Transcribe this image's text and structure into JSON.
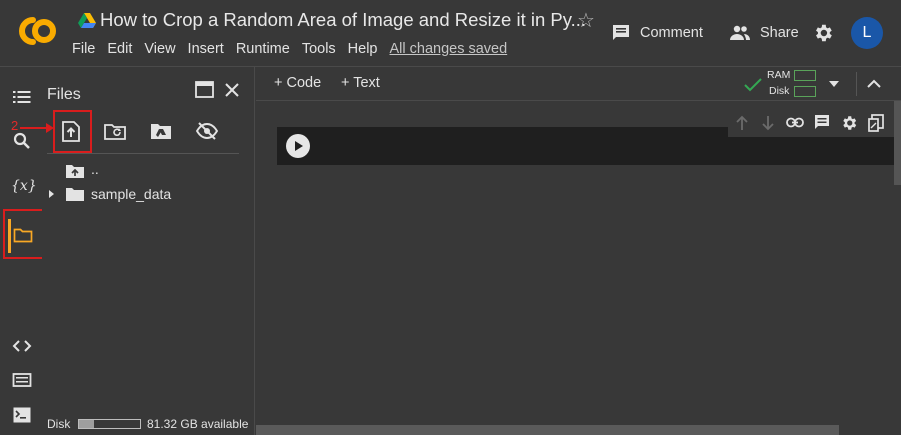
{
  "app": {
    "document_title": "How to Crop a Random Area of Image and Resize it in Py...",
    "menu": [
      "File",
      "Edit",
      "View",
      "Insert",
      "Runtime",
      "Tools",
      "Help"
    ],
    "save_status": "All changes saved",
    "comment_label": "Comment",
    "share_label": "Share",
    "avatar_initial": "L"
  },
  "files_panel": {
    "title": "Files",
    "parent_dir_label": "..",
    "folder_label": "sample_data",
    "disk_label": "Disk",
    "disk_available": "81.32 GB available",
    "disk_used_fraction": 0.24
  },
  "notebook": {
    "add_code_label": "+ Code",
    "add_text_label": "+ Text",
    "ram_label": "RAM",
    "disk_label": "Disk"
  },
  "annotations": {
    "step1": "1",
    "step2": "2"
  },
  "colors": {
    "background": "#383838",
    "cell": "#1f1f1f",
    "folder_active": "#f9a825",
    "annotation": "#d91d1d",
    "avatar": "#1a57a8",
    "connected_check": "#34a853"
  }
}
